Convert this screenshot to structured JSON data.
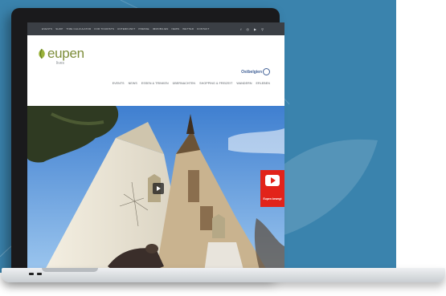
{
  "topbar": {
    "links": [
      "EVENTS",
      "SHOP",
      "TIME CALCULATOR",
      "FOR TOURISTS",
      "UNTERKUNFT",
      "PRESSE",
      "IMMOBILIEN",
      "NEWS",
      "WETTER",
      "KONTAKT"
    ],
    "social_icons": [
      "facebook-icon",
      "instagram-icon",
      "youtube-icon",
      "search-icon"
    ]
  },
  "header": {
    "logo_text": "eupen",
    "logo_sub": "lives",
    "region_logo": "Ostbelgien",
    "nav": [
      "EVENTS",
      "NEWS",
      "ESSEN & TRINKEN",
      "ÜBERNACHTEN",
      "SHOPPING & FREIZEIT",
      "WANDERN",
      "ERLEBEN"
    ]
  },
  "hero": {
    "youtube_label": "Eupen bewegt"
  },
  "colors": {
    "background_panel": "#3a83ad",
    "brand_green": "#7d8d3a",
    "topbar": "#3b3f45",
    "youtube_red": "#e2231a",
    "sky": "#4d8fd6"
  }
}
